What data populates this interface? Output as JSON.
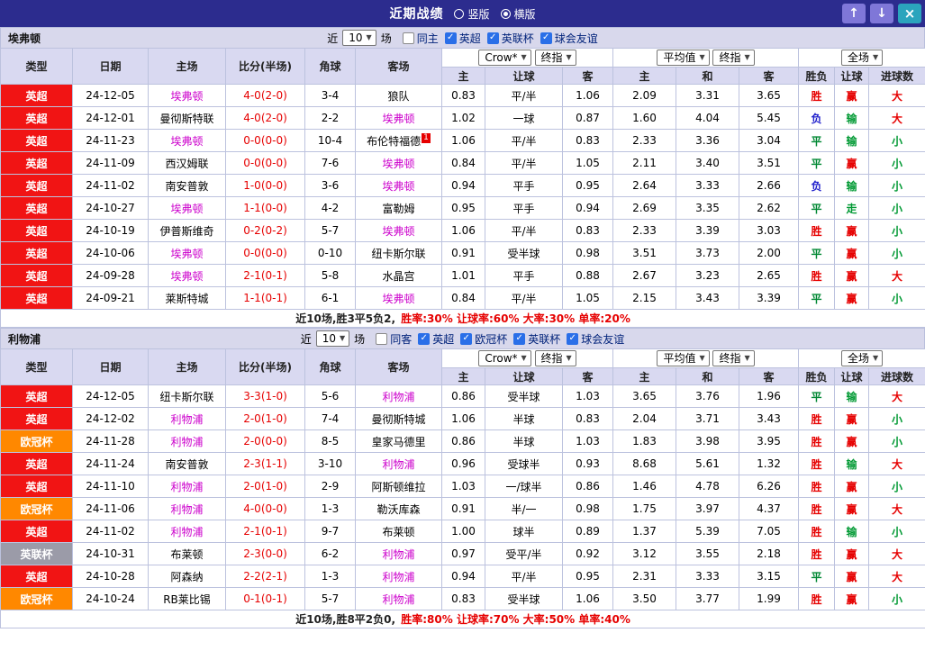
{
  "titlebar": {
    "title": "近期战绩",
    "radio_vertical": "竖版",
    "radio_horizontal": "横版",
    "selected_layout": "横版",
    "icons": {
      "up": "↑",
      "down": "↓",
      "close": "×"
    }
  },
  "columns": {
    "type": "类型",
    "date": "日期",
    "home": "主场",
    "score": "比分(半场)",
    "corner": "角球",
    "away": "客场",
    "asian_home": "主",
    "asian_handicap": "让球",
    "asian_away": "客",
    "euro_home": "主",
    "euro_draw": "和",
    "euro_away": "客",
    "result": "胜负",
    "handicap_result": "让球",
    "goals": "进球数"
  },
  "colors": {
    "league": {
      "英超": "#f11414",
      "欧冠杯": "#ff8800",
      "英联杯": "#9b9ba8"
    },
    "outcome": {
      "胜": "#e60000",
      "平": "#008833",
      "负": "#2222cc",
      "赢": "#e60000",
      "输": "#009933",
      "走": "#009933",
      "大": "#e60000",
      "小": "#009933"
    },
    "highlight_team": "#cc00cc",
    "score": "#e60000"
  },
  "sections": [
    {
      "team": "埃弗顿",
      "filter": {
        "near": "近",
        "count": "10",
        "unit": "场",
        "checkboxes": [
          {
            "label": "同主",
            "checked": false
          },
          {
            "label": "英超",
            "checked": true
          },
          {
            "label": "英联杯",
            "checked": true
          },
          {
            "label": "球会友谊",
            "checked": true
          }
        ]
      },
      "dropdowns": {
        "asian_source": "Crow*",
        "asian_period": "终指",
        "euro_source": "平均值",
        "euro_period": "终指",
        "scope": "全场"
      },
      "rows": [
        {
          "league": "英超",
          "date": "24-12-05",
          "home": "埃弗顿",
          "score": "4-0(2-0)",
          "corner": "3-4",
          "away": "狼队",
          "asian_home": "0.83",
          "handicap": "平/半",
          "asian_away": "1.06",
          "euro_home": "2.09",
          "euro_draw": "3.31",
          "euro_away": "3.65",
          "result": "胜",
          "handicap_result": "赢",
          "goals": "大"
        },
        {
          "league": "英超",
          "date": "24-12-01",
          "home": "曼彻斯特联",
          "score": "4-0(2-0)",
          "corner": "2-2",
          "away": "埃弗顿",
          "asian_home": "1.02",
          "handicap": "一球",
          "asian_away": "0.87",
          "euro_home": "1.60",
          "euro_draw": "4.04",
          "euro_away": "5.45",
          "result": "负",
          "handicap_result": "输",
          "goals": "大"
        },
        {
          "league": "英超",
          "date": "24-11-23",
          "home": "埃弗顿",
          "score": "0-0(0-0)",
          "corner": "10-4",
          "away": "布伦特福德",
          "away_badge": "1",
          "asian_home": "1.06",
          "handicap": "平/半",
          "asian_away": "0.83",
          "euro_home": "2.33",
          "euro_draw": "3.36",
          "euro_away": "3.04",
          "result": "平",
          "handicap_result": "输",
          "goals": "小"
        },
        {
          "league": "英超",
          "date": "24-11-09",
          "home": "西汉姆联",
          "score": "0-0(0-0)",
          "corner": "7-6",
          "away": "埃弗顿",
          "asian_home": "0.84",
          "handicap": "平/半",
          "asian_away": "1.05",
          "euro_home": "2.11",
          "euro_draw": "3.40",
          "euro_away": "3.51",
          "result": "平",
          "handicap_result": "赢",
          "goals": "小"
        },
        {
          "league": "英超",
          "date": "24-11-02",
          "home": "南安普敦",
          "score": "1-0(0-0)",
          "corner": "3-6",
          "away": "埃弗顿",
          "asian_home": "0.94",
          "handicap": "平手",
          "asian_away": "0.95",
          "euro_home": "2.64",
          "euro_draw": "3.33",
          "euro_away": "2.66",
          "result": "负",
          "handicap_result": "输",
          "goals": "小"
        },
        {
          "league": "英超",
          "date": "24-10-27",
          "home": "埃弗顿",
          "score": "1-1(0-0)",
          "corner": "4-2",
          "away": "富勒姆",
          "asian_home": "0.95",
          "handicap": "平手",
          "asian_away": "0.94",
          "euro_home": "2.69",
          "euro_draw": "3.35",
          "euro_away": "2.62",
          "result": "平",
          "handicap_result": "走",
          "goals": "小"
        },
        {
          "league": "英超",
          "date": "24-10-19",
          "home": "伊普斯维奇",
          "score": "0-2(0-2)",
          "corner": "5-7",
          "away": "埃弗顿",
          "asian_home": "1.06",
          "handicap": "平/半",
          "asian_away": "0.83",
          "euro_home": "2.33",
          "euro_draw": "3.39",
          "euro_away": "3.03",
          "result": "胜",
          "handicap_result": "赢",
          "goals": "小"
        },
        {
          "league": "英超",
          "date": "24-10-06",
          "home": "埃弗顿",
          "score": "0-0(0-0)",
          "corner": "0-10",
          "away": "纽卡斯尔联",
          "asian_home": "0.91",
          "handicap": "受半球",
          "asian_away": "0.98",
          "euro_home": "3.51",
          "euro_draw": "3.73",
          "euro_away": "2.00",
          "result": "平",
          "handicap_result": "赢",
          "goals": "小"
        },
        {
          "league": "英超",
          "date": "24-09-28",
          "home": "埃弗顿",
          "score": "2-1(0-1)",
          "corner": "5-8",
          "away": "水晶宫",
          "asian_home": "1.01",
          "handicap": "平手",
          "asian_away": "0.88",
          "euro_home": "2.67",
          "euro_draw": "3.23",
          "euro_away": "2.65",
          "result": "胜",
          "handicap_result": "赢",
          "goals": "大"
        },
        {
          "league": "英超",
          "date": "24-09-21",
          "home": "莱斯特城",
          "score": "1-1(0-1)",
          "corner": "6-1",
          "away": "埃弗顿",
          "asian_home": "0.84",
          "handicap": "平/半",
          "asian_away": "1.05",
          "euro_home": "2.15",
          "euro_draw": "3.43",
          "euro_away": "3.39",
          "result": "平",
          "handicap_result": "赢",
          "goals": "小"
        }
      ],
      "summary": {
        "prefix": "近10场,胜3平5负2, ",
        "stats": "胜率:30% 让球率:60% 大率:30% 单率:20%"
      }
    },
    {
      "team": "利物浦",
      "filter": {
        "near": "近",
        "count": "10",
        "unit": "场",
        "checkboxes": [
          {
            "label": "同客",
            "checked": false
          },
          {
            "label": "英超",
            "checked": true
          },
          {
            "label": "欧冠杯",
            "checked": true
          },
          {
            "label": "英联杯",
            "checked": true
          },
          {
            "label": "球会友谊",
            "checked": true
          }
        ]
      },
      "dropdowns": {
        "asian_source": "Crow*",
        "asian_period": "终指",
        "euro_source": "平均值",
        "euro_period": "终指",
        "scope": "全场"
      },
      "rows": [
        {
          "league": "英超",
          "date": "24-12-05",
          "home": "纽卡斯尔联",
          "score": "3-3(1-0)",
          "corner": "5-6",
          "away": "利物浦",
          "asian_home": "0.86",
          "handicap": "受半球",
          "asian_away": "1.03",
          "euro_home": "3.65",
          "euro_draw": "3.76",
          "euro_away": "1.96",
          "result": "平",
          "handicap_result": "输",
          "goals": "大"
        },
        {
          "league": "英超",
          "date": "24-12-02",
          "home": "利物浦",
          "score": "2-0(1-0)",
          "corner": "7-4",
          "away": "曼彻斯特城",
          "asian_home": "1.06",
          "handicap": "半球",
          "asian_away": "0.83",
          "euro_home": "2.04",
          "euro_draw": "3.71",
          "euro_away": "3.43",
          "result": "胜",
          "handicap_result": "赢",
          "goals": "小"
        },
        {
          "league": "欧冠杯",
          "date": "24-11-28",
          "home": "利物浦",
          "score": "2-0(0-0)",
          "corner": "8-5",
          "away": "皇家马德里",
          "asian_home": "0.86",
          "handicap": "半球",
          "asian_away": "1.03",
          "euro_home": "1.83",
          "euro_draw": "3.98",
          "euro_away": "3.95",
          "result": "胜",
          "handicap_result": "赢",
          "goals": "小"
        },
        {
          "league": "英超",
          "date": "24-11-24",
          "home": "南安普敦",
          "score": "2-3(1-1)",
          "corner": "3-10",
          "away": "利物浦",
          "asian_home": "0.96",
          "handicap": "受球半",
          "asian_away": "0.93",
          "euro_home": "8.68",
          "euro_draw": "5.61",
          "euro_away": "1.32",
          "result": "胜",
          "handicap_result": "输",
          "goals": "大"
        },
        {
          "league": "英超",
          "date": "24-11-10",
          "home": "利物浦",
          "score": "2-0(1-0)",
          "corner": "2-9",
          "away": "阿斯顿维拉",
          "asian_home": "1.03",
          "handicap": "一/球半",
          "asian_away": "0.86",
          "euro_home": "1.46",
          "euro_draw": "4.78",
          "euro_away": "6.26",
          "result": "胜",
          "handicap_result": "赢",
          "goals": "小"
        },
        {
          "league": "欧冠杯",
          "date": "24-11-06",
          "home": "利物浦",
          "score": "4-0(0-0)",
          "corner": "1-3",
          "away": "勒沃库森",
          "asian_home": "0.91",
          "handicap": "半/一",
          "asian_away": "0.98",
          "euro_home": "1.75",
          "euro_draw": "3.97",
          "euro_away": "4.37",
          "result": "胜",
          "handicap_result": "赢",
          "goals": "大"
        },
        {
          "league": "英超",
          "date": "24-11-02",
          "home": "利物浦",
          "score": "2-1(0-1)",
          "corner": "9-7",
          "away": "布莱顿",
          "asian_home": "1.00",
          "handicap": "球半",
          "asian_away": "0.89",
          "euro_home": "1.37",
          "euro_draw": "5.39",
          "euro_away": "7.05",
          "result": "胜",
          "handicap_result": "输",
          "goals": "小"
        },
        {
          "league": "英联杯",
          "date": "24-10-31",
          "home": "布莱顿",
          "score": "2-3(0-0)",
          "corner": "6-2",
          "away": "利物浦",
          "asian_home": "0.97",
          "handicap": "受平/半",
          "asian_away": "0.92",
          "euro_home": "3.12",
          "euro_draw": "3.55",
          "euro_away": "2.18",
          "result": "胜",
          "handicap_result": "赢",
          "goals": "大"
        },
        {
          "league": "英超",
          "date": "24-10-28",
          "home": "阿森纳",
          "score": "2-2(2-1)",
          "corner": "1-3",
          "away": "利物浦",
          "asian_home": "0.94",
          "handicap": "平/半",
          "asian_away": "0.95",
          "euro_home": "2.31",
          "euro_draw": "3.33",
          "euro_away": "3.15",
          "result": "平",
          "handicap_result": "赢",
          "goals": "大"
        },
        {
          "league": "欧冠杯",
          "date": "24-10-24",
          "home": "RB莱比锡",
          "score": "0-1(0-1)",
          "corner": "5-7",
          "away": "利物浦",
          "asian_home": "0.83",
          "handicap": "受半球",
          "asian_away": "1.06",
          "euro_home": "3.50",
          "euro_draw": "3.77",
          "euro_away": "1.99",
          "result": "胜",
          "handicap_result": "赢",
          "goals": "小"
        }
      ],
      "summary": {
        "prefix": "近10场,胜8平2负0, ",
        "stats": "胜率:80% 让球率:70% 大率:50% 单率:40%"
      }
    }
  ]
}
